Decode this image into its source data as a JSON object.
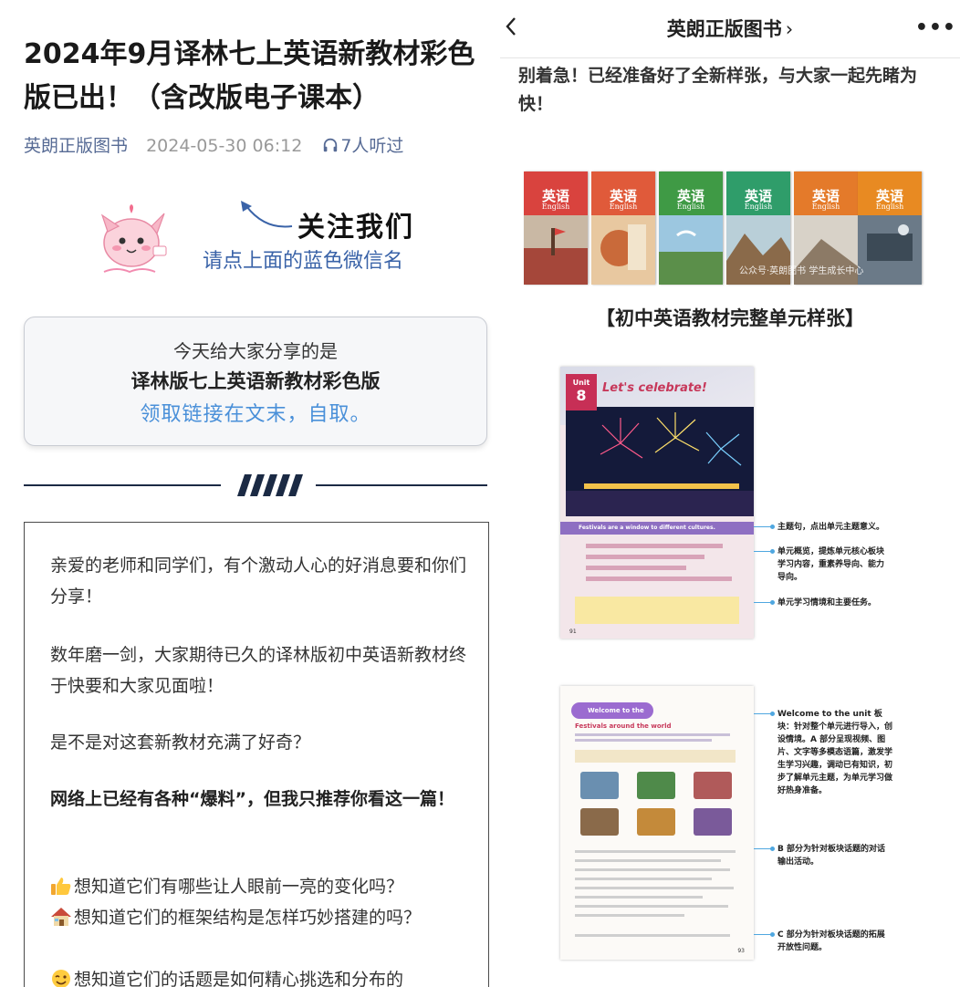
{
  "article": {
    "title": "2024年9月译林七上英语新教材彩色版已出！（含改版电子课本）",
    "account": "英朗正版图书",
    "date": "2024-05-30 06:12",
    "listeners": "7人听过",
    "follow_big": "关注我们",
    "follow_small": "请点上面的蓝色微信名",
    "share_line1": "今天给大家分享的是",
    "share_line2": "译林版七上英语新教材彩色版",
    "share_line3": "领取链接在文末，自取。",
    "paragraphs": [
      "亲爱的老师和同学们，有个激动人心的好消息要和你们分享！",
      "数年磨一剑，大家期待已久的译林版初中英语新教材终于快要和大家见面啦！",
      "是不是对这套新教材充满了好奇？",
      "网络上已经有各种“爆料”，但我只推荐你看这一篇！"
    ],
    "bullets": [
      {
        "icon": "thumbs-up-icon",
        "text": "想知道它们有哪些让人眼前一亮的变化吗？"
      },
      {
        "icon": "house-icon",
        "text": "想知道它们的框架结构是怎样巧妙搭建的吗？"
      },
      {
        "icon": "wink-emoji-icon",
        "text": "想知道它们的话题是如何精心挑选和分布的"
      }
    ]
  },
  "right": {
    "nav_title": "英朗正版图书",
    "nav_more": "•••",
    "intro": "别着急！已经准备好了全新样张，与大家一起先睹为快！",
    "books": [
      {
        "cn": "英语",
        "en": "English",
        "color": "#d9433e"
      },
      {
        "cn": "英语",
        "en": "English",
        "color": "#e05a3a"
      },
      {
        "cn": "英语",
        "en": "English",
        "color": "#3f9a45"
      },
      {
        "cn": "英语",
        "en": "English",
        "color": "#2f9d6a"
      },
      {
        "cn": "英语",
        "en": "English",
        "color": "#e47a2a"
      },
      {
        "cn": "英语",
        "en": "English",
        "color": "#e88a22"
      }
    ],
    "watermark": "公众号·英朗图书 学生成长中心",
    "section_title": "【初中英语教材完整单元样张】",
    "page1": {
      "unit_label": "Unit",
      "unit_number": "8",
      "unit_title": "Let's celebrate!",
      "band_text": "Festivals are a window to different cultures.",
      "page_number": "91"
    },
    "page2": {
      "header": "Welcome to the unit",
      "subtitle": "Festivals around the world",
      "page_number": "93"
    },
    "annotations": [
      "主题句，点出单元主题意义。",
      "单元概览，提炼单元核心板块学习内容，重素养导向、能力导向。",
      "单元学习情境和主要任务。",
      "Welcome to the unit 板块：针对整个单元进行导入，创设情境。A 部分呈现视频、图片、文字等多模态语篇，激发学生学习兴趣，调动已有知识，初步了解单元主题，为单元学习做好热身准备。",
      "B 部分为针对板块话题的对话输出活动。",
      "C 部分为针对板块话题的拓展开放性问题。"
    ]
  }
}
